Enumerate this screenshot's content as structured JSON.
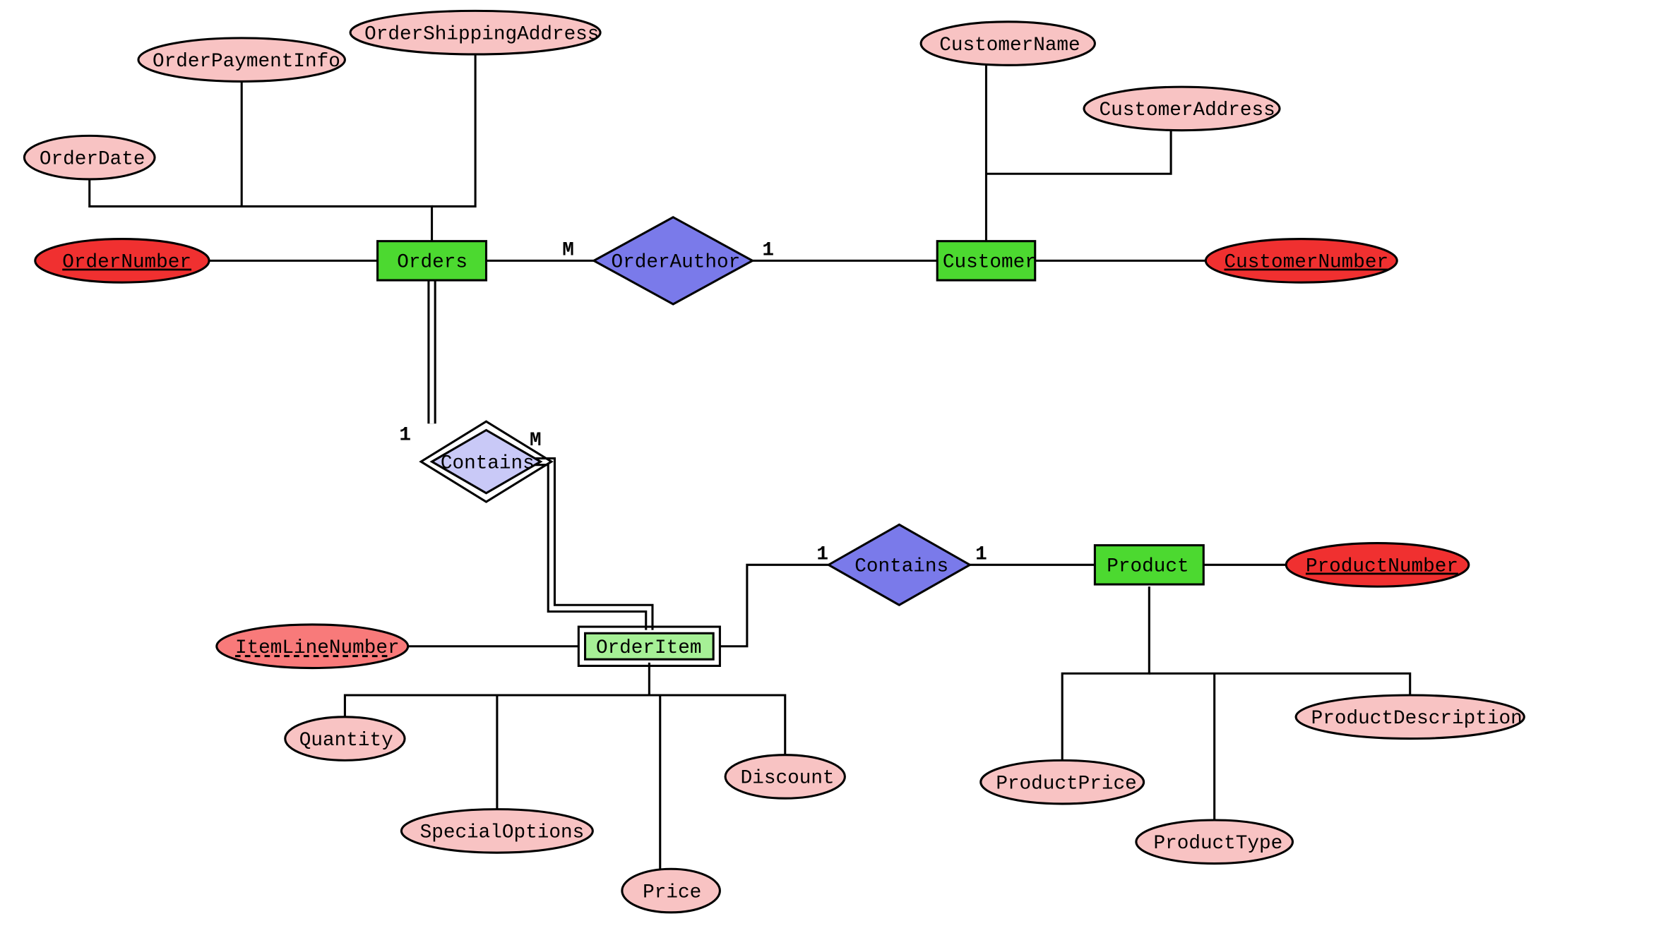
{
  "entities": {
    "orders": "Orders",
    "customer": "Customer",
    "orderitem": "OrderItem",
    "product": "Product"
  },
  "relationships": {
    "orderauthor": "OrderAuthor",
    "contains_orders_orderitem": "Contains",
    "contains_orderitem_product": "Contains"
  },
  "attributes": {
    "ordernumber": "OrderNumber",
    "orderdate": "OrderDate",
    "orderpaymentinfo": "OrderPaymentInfo",
    "ordershippingaddress": "OrderShippingAddress",
    "customername": "CustomerName",
    "customeraddress": "CustomerAddress",
    "customernumber": "CustomerNumber",
    "itemlinenumber": "ItemLineNumber",
    "quantity": "Quantity",
    "specialoptions": "SpecialOptions",
    "price": "Price",
    "discount": "Discount",
    "productnumber": "ProductNumber",
    "productprice": "ProductPrice",
    "producttype": "ProductType",
    "productdescription": "ProductDescription"
  },
  "cardinalities": {
    "orders_orderauthor": "M",
    "customer_orderauthor": "1",
    "orders_contains": "1",
    "orderitem_contains_orders": "M",
    "orderitem_contains_product": "1",
    "product_contains": "1"
  }
}
